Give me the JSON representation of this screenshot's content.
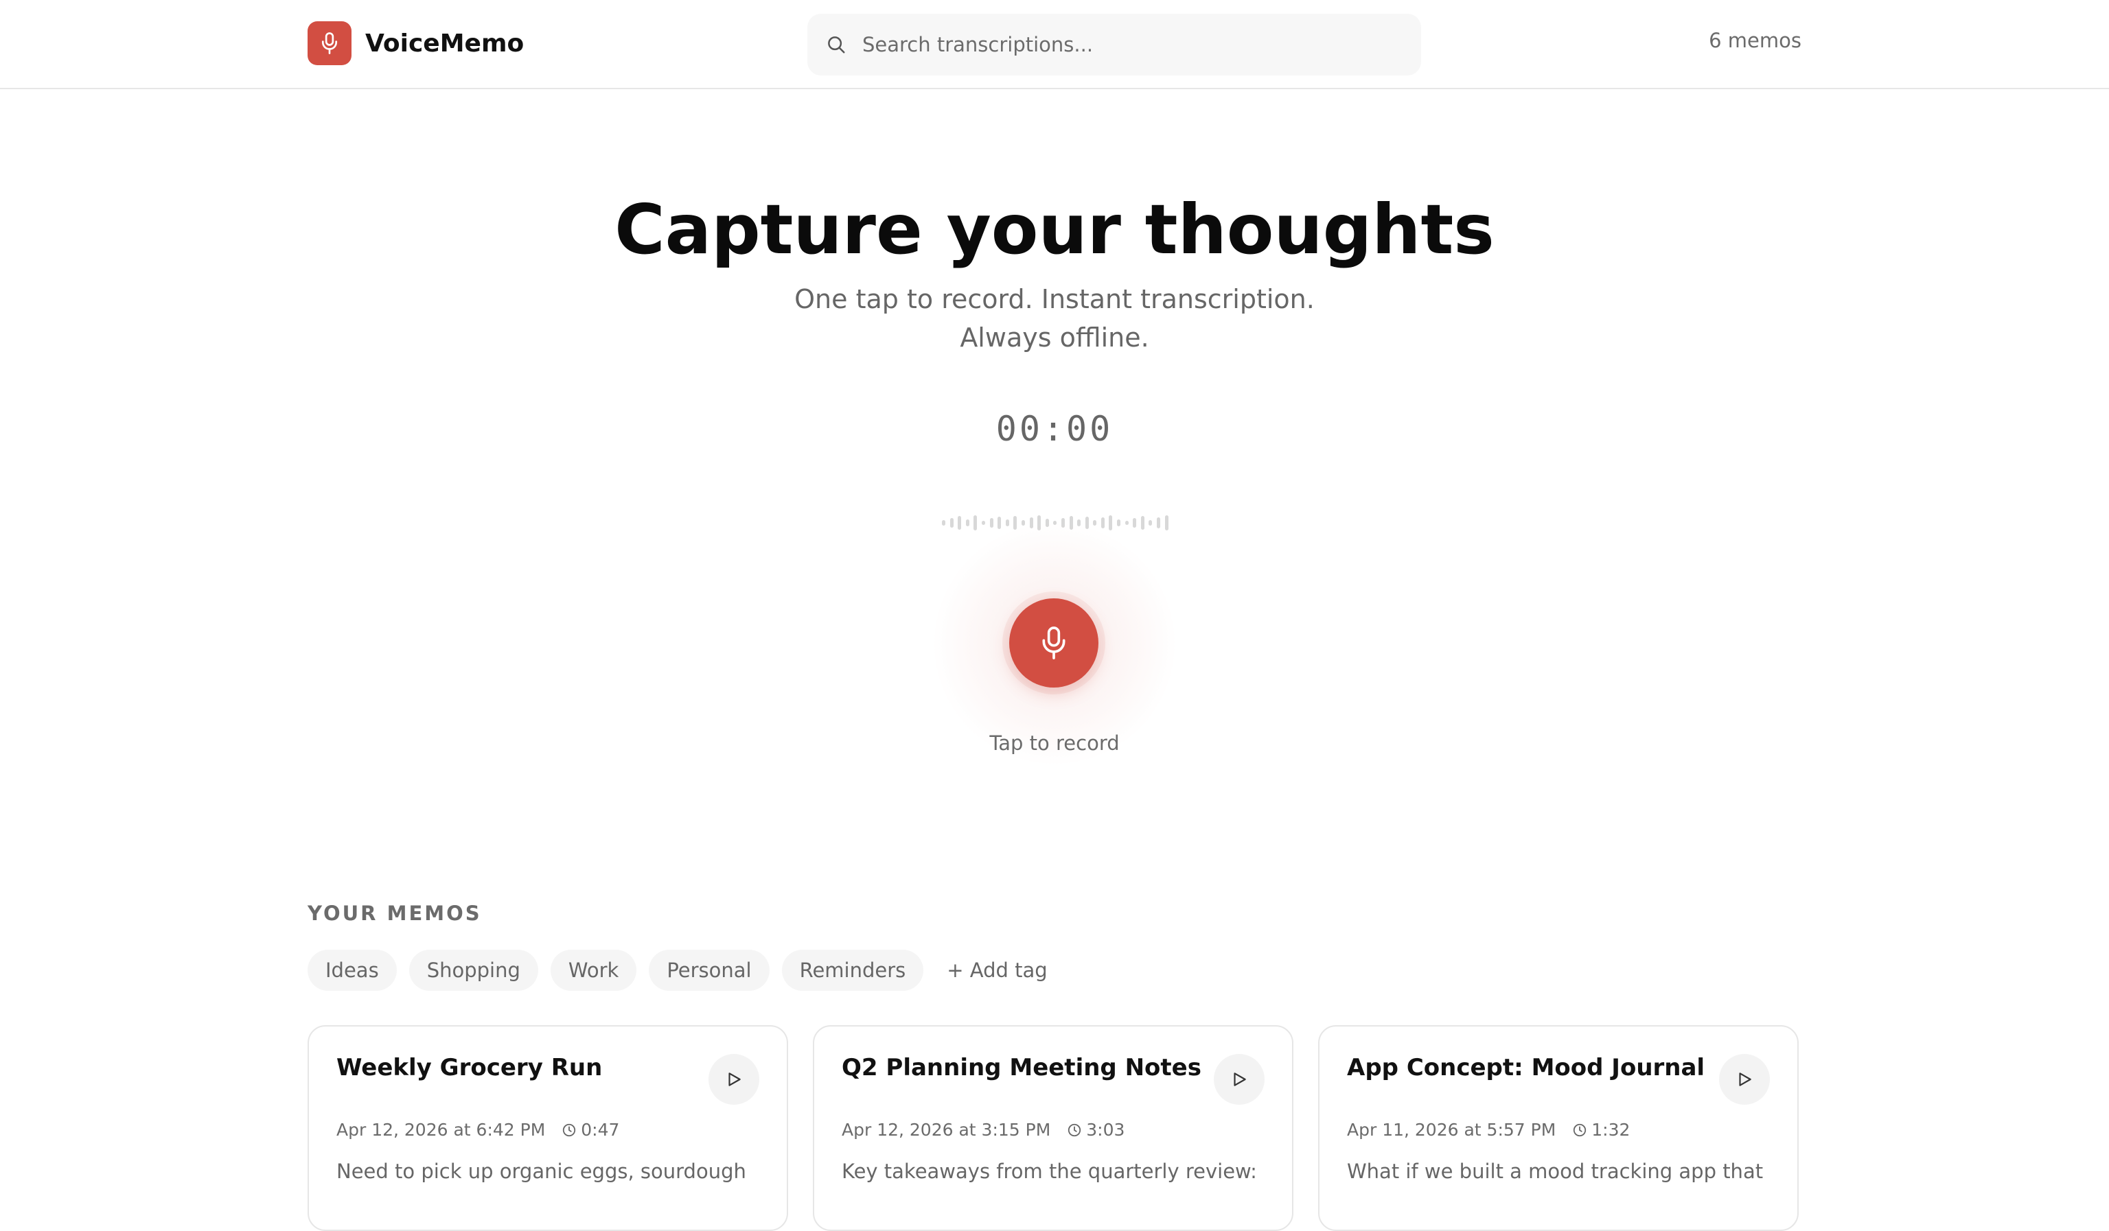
{
  "app": {
    "name": "VoiceMemo",
    "brand_color": "#d24e42",
    "logo_icon": "microphone-icon"
  },
  "search": {
    "placeholder": "Search transcriptions...",
    "value": "",
    "icon": "search-icon"
  },
  "header": {
    "memo_count": "6 memos"
  },
  "hero": {
    "title": "Capture your thoughts",
    "subtitle": "One tap to record. Instant transcription. Always offline.",
    "timer": "00:00",
    "record_label": "Tap to record",
    "record_icon": "microphone-icon"
  },
  "memos": {
    "section_title": "YOUR MEMOS",
    "tags": [
      "Ideas",
      "Shopping",
      "Work",
      "Personal",
      "Reminders"
    ],
    "add_tag_label": "+ Add tag",
    "cards": [
      {
        "title": "Weekly Grocery Run",
        "date": "Apr 12, 2026 at 6:42 PM",
        "duration": "0:47",
        "preview": "Need to pick up organic eggs, sourdough"
      },
      {
        "title": "Q2 Planning Meeting Notes",
        "date": "Apr 12, 2026 at 3:15 PM",
        "duration": "3:03",
        "preview": "Key takeaways from the quarterly review:"
      },
      {
        "title": "App Concept: Mood Journal",
        "date": "Apr 11, 2026 at 5:57 PM",
        "duration": "1:32",
        "preview": "What if we built a mood tracking app that"
      }
    ]
  }
}
